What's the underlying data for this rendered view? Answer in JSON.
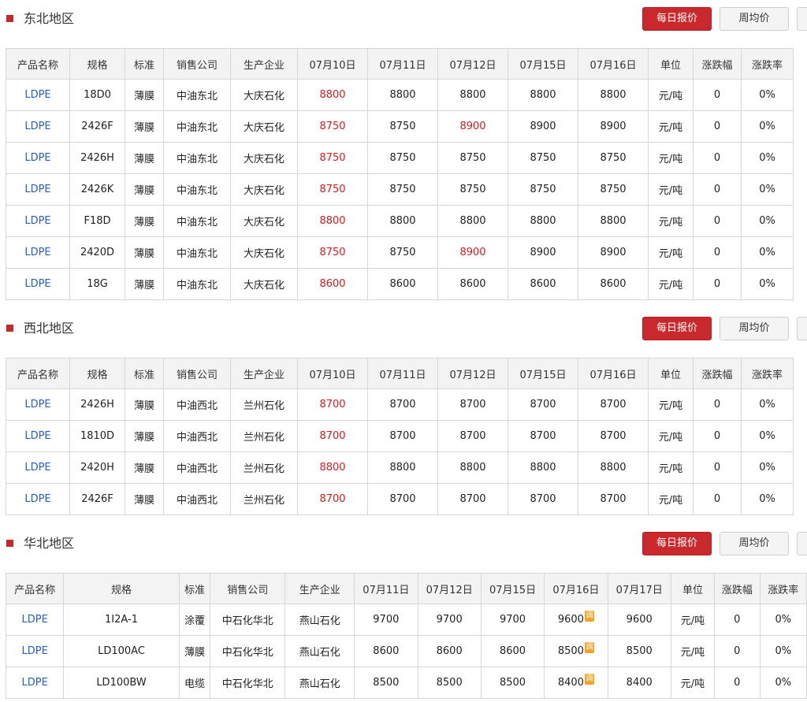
{
  "buttons": {
    "daily": "每日报价",
    "weekly": "周均价"
  },
  "colors": {
    "accent": "#c9282d",
    "up": "#e0191e",
    "link": "#2a5ec7",
    "adjust_badge": "#f0a323"
  },
  "adjust_badge_text": "调",
  "sections": [
    {
      "title": "东北地区",
      "headers": [
        "产品名称",
        "规格",
        "标准",
        "销售公司",
        "生产企业",
        "07月10日",
        "07月11日",
        "07月12日",
        "07月15日",
        "07月16日",
        "单位",
        "涨跌幅",
        "涨跌率"
      ],
      "rows": [
        [
          "LDPE",
          "18D0",
          "薄膜",
          "中油东北",
          "大庆石化",
          "8800",
          "8800",
          "8800",
          "8800",
          "8800",
          "元/吨",
          "0",
          "0%"
        ],
        [
          "LDPE",
          "2426F",
          "薄膜",
          "中油东北",
          "大庆石化",
          "8750",
          "8750",
          "8900",
          "8900",
          "8900",
          "元/吨",
          "0",
          "0%"
        ],
        [
          "LDPE",
          "2426H",
          "薄膜",
          "中油东北",
          "大庆石化",
          "8750",
          "8750",
          "8750",
          "8750",
          "8750",
          "元/吨",
          "0",
          "0%"
        ],
        [
          "LDPE",
          "2426K",
          "薄膜",
          "中油东北",
          "大庆石化",
          "8750",
          "8750",
          "8750",
          "8750",
          "8750",
          "元/吨",
          "0",
          "0%"
        ],
        [
          "LDPE",
          "F18D",
          "薄膜",
          "中油东北",
          "大庆石化",
          "8800",
          "8800",
          "8800",
          "8800",
          "8800",
          "元/吨",
          "0",
          "0%"
        ],
        [
          "LDPE",
          "2420D",
          "薄膜",
          "中油东北",
          "大庆石化",
          "8750",
          "8750",
          "8900",
          "8900",
          "8900",
          "元/吨",
          "0",
          "0%"
        ],
        [
          "LDPE",
          "18G",
          "薄膜",
          "中油东北",
          "大庆石化",
          "8600",
          "8600",
          "8600",
          "8600",
          "8600",
          "元/吨",
          "0",
          "0%"
        ]
      ],
      "red_cells": [
        [
          0,
          5
        ],
        [
          1,
          5
        ],
        [
          1,
          7
        ],
        [
          2,
          5
        ],
        [
          3,
          5
        ],
        [
          4,
          5
        ],
        [
          5,
          5
        ],
        [
          5,
          7
        ],
        [
          6,
          5
        ]
      ],
      "adjust_cells": []
    },
    {
      "title": "西北地区",
      "headers": [
        "产品名称",
        "规格",
        "标准",
        "销售公司",
        "生产企业",
        "07月10日",
        "07月11日",
        "07月12日",
        "07月15日",
        "07月16日",
        "单位",
        "涨跌幅",
        "涨跌率"
      ],
      "rows": [
        [
          "LDPE",
          "2426H",
          "薄膜",
          "中油西北",
          "兰州石化",
          "8700",
          "8700",
          "8700",
          "8700",
          "8700",
          "元/吨",
          "0",
          "0%"
        ],
        [
          "LDPE",
          "1810D",
          "薄膜",
          "中油西北",
          "兰州石化",
          "8700",
          "8700",
          "8700",
          "8700",
          "8700",
          "元/吨",
          "0",
          "0%"
        ],
        [
          "LDPE",
          "2420H",
          "薄膜",
          "中油西北",
          "兰州石化",
          "8800",
          "8800",
          "8800",
          "8800",
          "8800",
          "元/吨",
          "0",
          "0%"
        ],
        [
          "LDPE",
          "2426F",
          "薄膜",
          "中油西北",
          "兰州石化",
          "8700",
          "8700",
          "8700",
          "8700",
          "8700",
          "元/吨",
          "0",
          "0%"
        ]
      ],
      "red_cells": [
        [
          0,
          5
        ],
        [
          1,
          5
        ],
        [
          2,
          5
        ],
        [
          3,
          5
        ]
      ],
      "adjust_cells": []
    },
    {
      "title": "华北地区",
      "headers": [
        "产品名称",
        "规格",
        "标准",
        "销售公司",
        "生产企业",
        "07月11日",
        "07月12日",
        "07月15日",
        "07月16日",
        "07月17日",
        "单位",
        "涨跌幅",
        "涨跌率"
      ],
      "rows": [
        [
          "LDPE",
          "1I2A-1",
          "涂覆",
          "中石化华北",
          "燕山石化",
          "9700",
          "9700",
          "9700",
          "9600",
          "9600",
          "元/吨",
          "0",
          "0%"
        ],
        [
          "LDPE",
          "LD100AC",
          "薄膜",
          "中石化华北",
          "燕山石化",
          "8600",
          "8600",
          "8600",
          "8500",
          "8500",
          "元/吨",
          "0",
          "0%"
        ],
        [
          "LDPE",
          "LD100BW",
          "电缆",
          "中石化华北",
          "燕山石化",
          "8500",
          "8500",
          "8500",
          "8400",
          "8400",
          "元/吨",
          "0",
          "0%"
        ]
      ],
      "red_cells": [],
      "adjust_cells": [
        [
          0,
          8
        ],
        [
          1,
          8
        ],
        [
          2,
          8
        ]
      ]
    }
  ]
}
